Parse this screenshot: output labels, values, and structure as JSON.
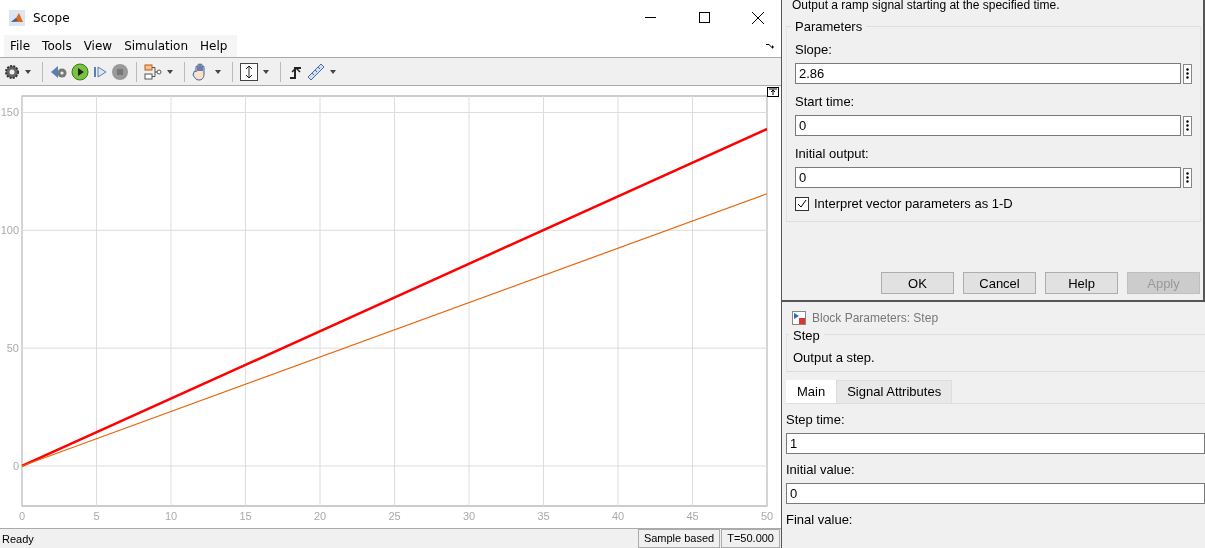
{
  "scope": {
    "title": "Scope",
    "menu": [
      "File",
      "Tools",
      "View",
      "Simulation",
      "Help"
    ],
    "chart_data": {
      "type": "line",
      "grid": true,
      "x": [
        0,
        50
      ],
      "xlim": [
        0,
        50
      ],
      "ylim": [
        -17,
        157
      ],
      "xticks": [
        0,
        5,
        10,
        15,
        20,
        25,
        30,
        35,
        40,
        45,
        50
      ],
      "yticks": [
        0,
        50,
        100,
        150
      ],
      "series": [
        {
          "color": "#ff0000",
          "values": [
            0,
            143
          ]
        },
        {
          "color": "#e8650a",
          "values": [
            0,
            115.5
          ]
        }
      ]
    },
    "status": {
      "text": "Ready",
      "mode": "Sample based",
      "time": "T=50.000"
    }
  },
  "ramp_dialog": {
    "description": "Output a ramp signal starting at the specified time.",
    "group": "Parameters",
    "fields": [
      {
        "label": "Slope:",
        "value": "2.86"
      },
      {
        "label": "Start time:",
        "value": "0"
      },
      {
        "label": "Initial output:",
        "value": "0"
      }
    ],
    "checkbox": {
      "label": "Interpret vector parameters as 1-D",
      "checked": true
    },
    "buttons": [
      {
        "label": "OK",
        "disabled": false
      },
      {
        "label": "Cancel",
        "disabled": false
      },
      {
        "label": "Help",
        "disabled": false
      },
      {
        "label": "Apply",
        "disabled": true
      }
    ]
  },
  "step_dialog": {
    "title": "Block Parameters: Step",
    "group": "Step",
    "description": "Output a step.",
    "tabs": [
      {
        "label": "Main",
        "selected": true
      },
      {
        "label": "Signal Attributes",
        "selected": false
      }
    ],
    "fields": [
      {
        "label": "Step time:",
        "value": "1"
      },
      {
        "label": "Initial value:",
        "value": "0"
      },
      {
        "label": "Final value:"
      }
    ]
  }
}
